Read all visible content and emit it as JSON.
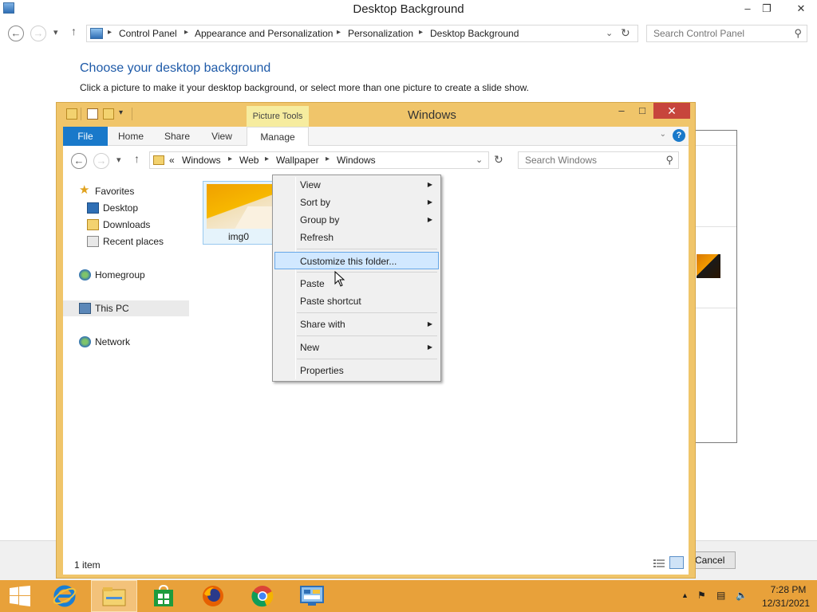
{
  "control_panel": {
    "title": "Desktop Background",
    "breadcrumbs": [
      "Control Panel",
      "Appearance and Personalization",
      "Personalization",
      "Desktop Background"
    ],
    "search_placeholder": "Search Control Panel",
    "heading": "Choose your desktop background",
    "subtext": "Click a picture to make it your desktop background, or select more than one picture to create a slide show.",
    "cancel_label": "Cancel"
  },
  "explorer": {
    "title": "Windows",
    "contextual_tab_group": "Picture Tools",
    "tabs": [
      "File",
      "Home",
      "Share",
      "View",
      "Manage"
    ],
    "breadcrumb_prefix": "«",
    "breadcrumbs": [
      "Windows",
      "Web",
      "Wallpaper",
      "Windows"
    ],
    "search_placeholder": "Search Windows",
    "nav_pane": {
      "favorites": "Favorites",
      "desktop": "Desktop",
      "downloads": "Downloads",
      "recent_places": "Recent places",
      "homegroup": "Homegroup",
      "this_pc": "This PC",
      "network": "Network"
    },
    "files": [
      {
        "name": "img0"
      }
    ],
    "status": "1 item"
  },
  "context_menu": {
    "items": [
      {
        "label": "View",
        "submenu": true
      },
      {
        "label": "Sort by",
        "submenu": true
      },
      {
        "label": "Group by",
        "submenu": true
      },
      {
        "label": "Refresh",
        "submenu": false
      },
      {
        "label": "Customize this folder...",
        "submenu": false,
        "highlighted": true
      },
      {
        "label": "Paste",
        "submenu": false
      },
      {
        "label": "Paste shortcut",
        "submenu": false
      },
      {
        "label": "Share with",
        "submenu": true
      },
      {
        "label": "New",
        "submenu": true
      },
      {
        "label": "Properties",
        "submenu": false
      }
    ]
  },
  "taskbar": {
    "apps": [
      "start-button",
      "internet-explorer",
      "file-explorer",
      "store",
      "firefox",
      "chrome",
      "control-panel"
    ],
    "time": "7:28 PM",
    "date": "12/31/2021"
  },
  "colors": {
    "accent": "#1979ca",
    "window_frame": "#f0c56a",
    "taskbar": "#e8a13a",
    "close_button": "#c7453c",
    "heading": "#1e5aa8",
    "menu_highlight": "#d1e8ff"
  }
}
